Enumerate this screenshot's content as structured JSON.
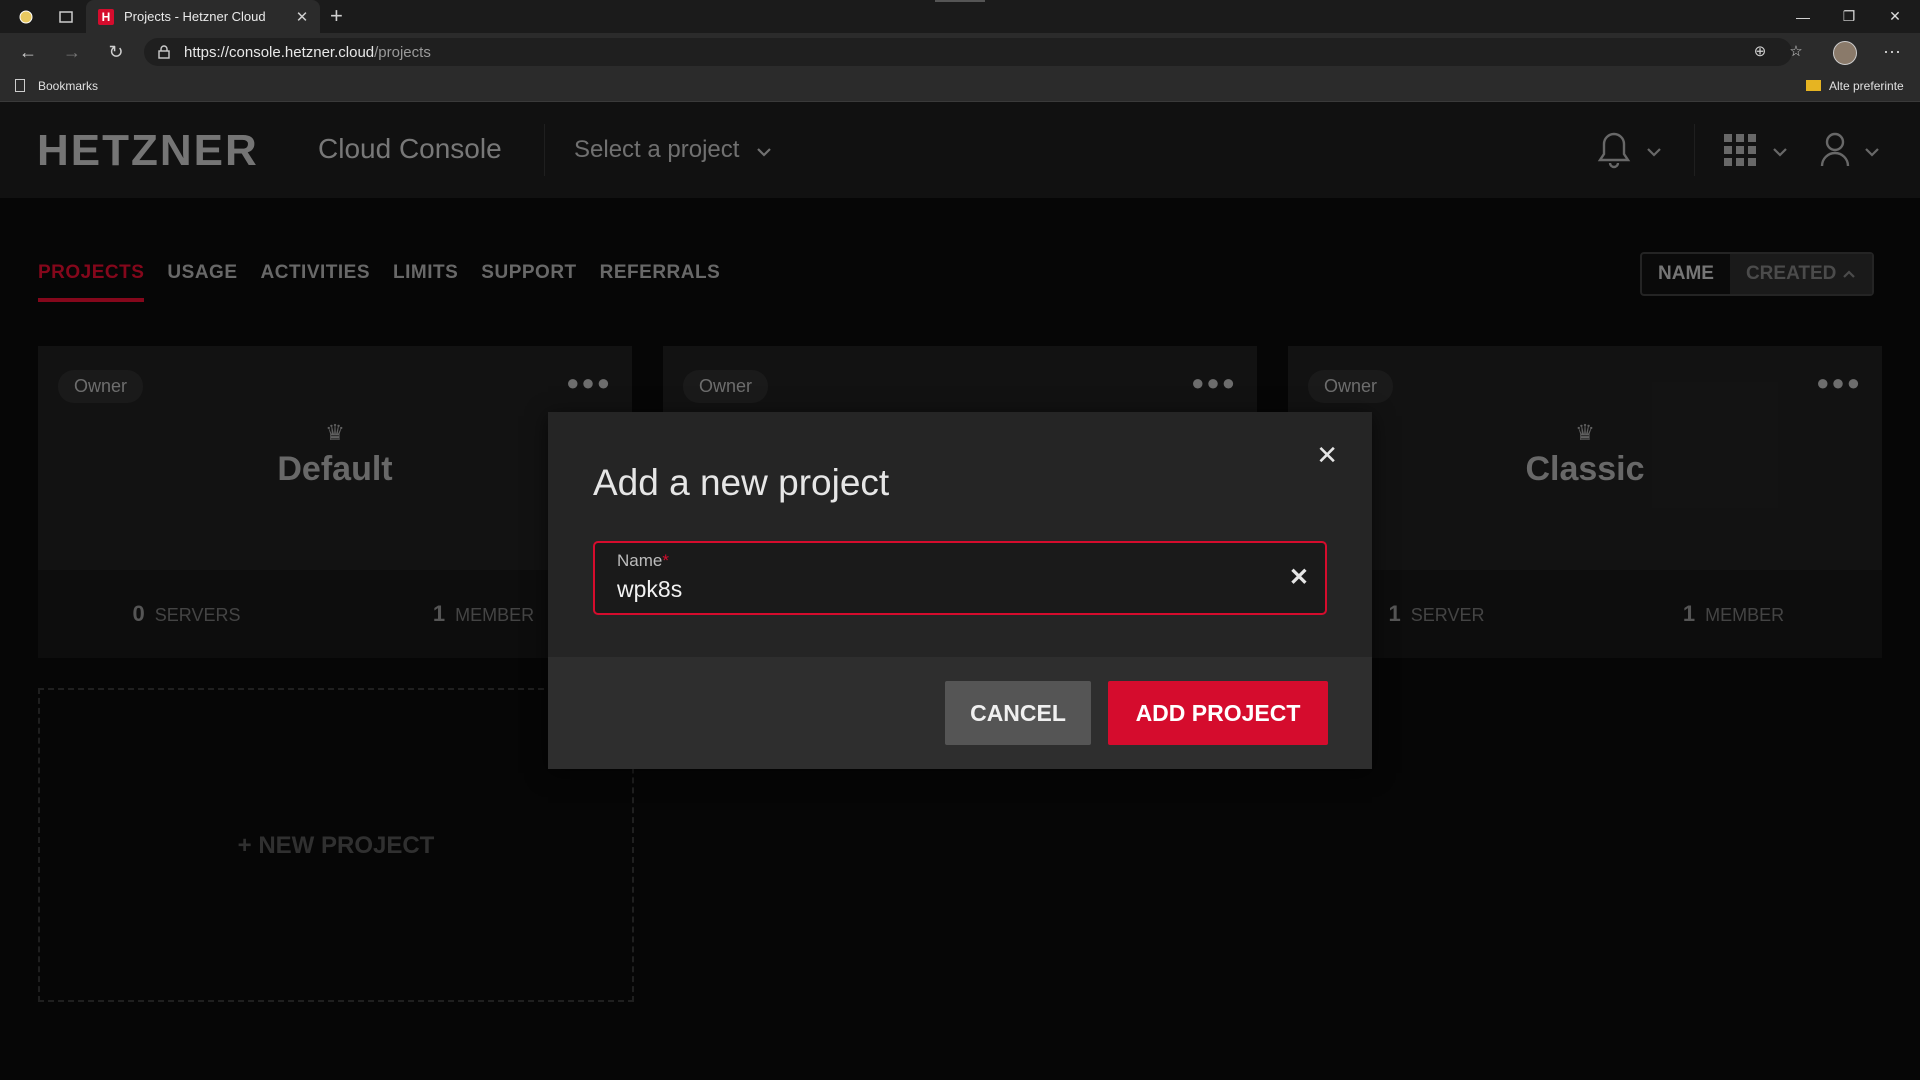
{
  "browser": {
    "tab_title": "Projects - Hetzner Cloud",
    "tab_favicon": "H",
    "url_host": "https://console.hetzner.cloud",
    "url_path": "/projects",
    "bookmarks_label": "Bookmarks",
    "other_favorites_label": "Alte preferinte"
  },
  "header": {
    "logo": "HETZNER",
    "app_name": "Cloud Console",
    "project_selector": "Select a project"
  },
  "nav": {
    "tabs": [
      {
        "label": "PROJECTS",
        "active": true
      },
      {
        "label": "USAGE"
      },
      {
        "label": "ACTIVITIES"
      },
      {
        "label": "LIMITS"
      },
      {
        "label": "SUPPORT"
      },
      {
        "label": "REFERRALS"
      }
    ],
    "sort_name": "NAME",
    "sort_created": "CREATED"
  },
  "projects": [
    {
      "role": "Owner",
      "name": "Default",
      "servers_count": "0",
      "servers_label": "SERVERS",
      "members_count": "1",
      "members_label": "MEMBER"
    },
    {
      "role": "Owner",
      "name": "",
      "servers_count": "",
      "servers_label": "",
      "members_count": "",
      "members_label": ""
    },
    {
      "role": "Owner",
      "name": "Classic",
      "servers_count": "1",
      "servers_label": "SERVER",
      "members_count": "1",
      "members_label": "MEMBER"
    }
  ],
  "new_project_label": "NEW PROJECT",
  "modal": {
    "title": "Add a new project",
    "name_label": "Name",
    "required_mark": "*",
    "name_value": "wpk8s",
    "cancel_label": "CANCEL",
    "add_label": "ADD PROJECT"
  },
  "colors": {
    "accent": "#d50c2d"
  }
}
